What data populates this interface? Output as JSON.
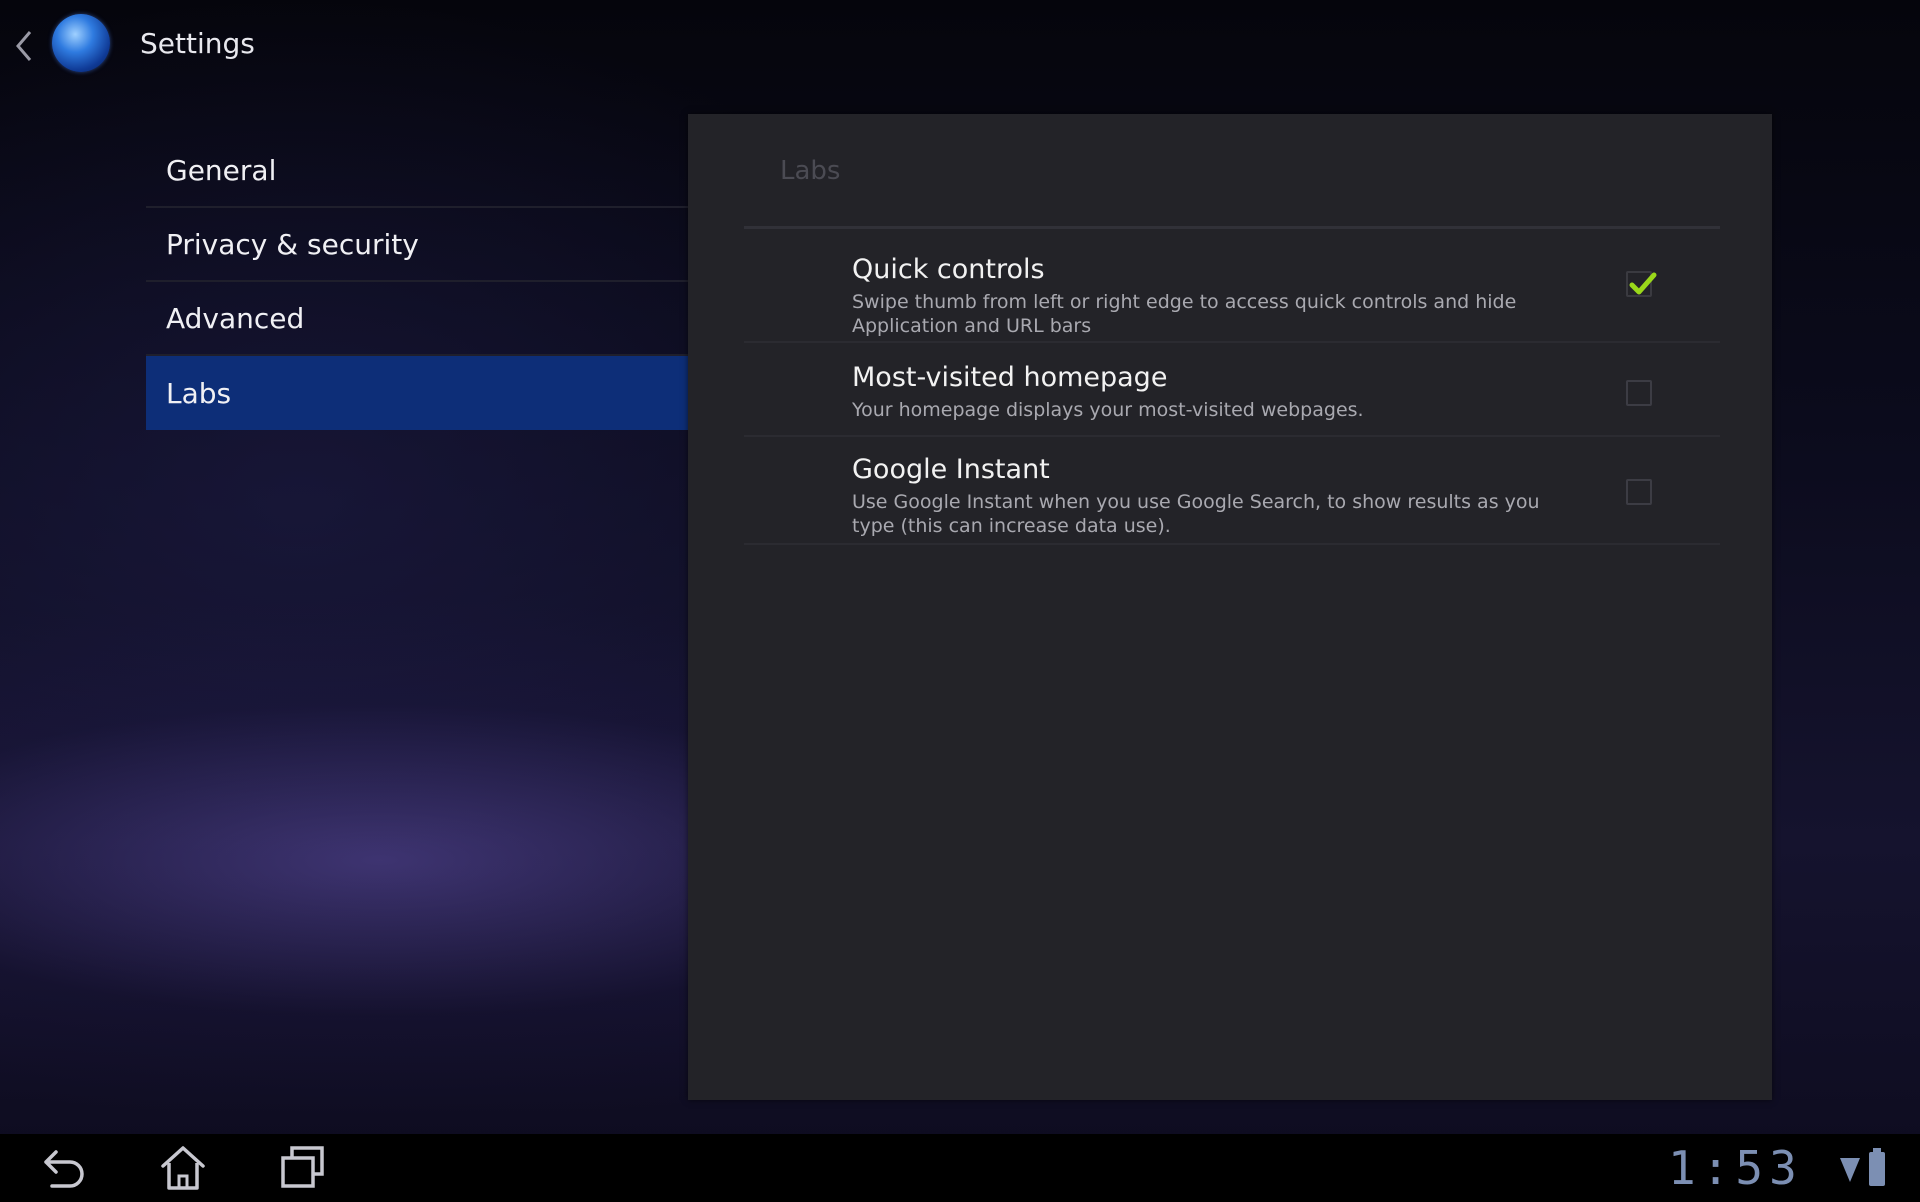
{
  "action_bar": {
    "title": "Settings"
  },
  "categories": [
    {
      "label": "General",
      "selected": false
    },
    {
      "label": "Privacy & security",
      "selected": false
    },
    {
      "label": "Advanced",
      "selected": false
    },
    {
      "label": "Labs",
      "selected": true
    }
  ],
  "pane": {
    "header": "Labs",
    "prefs": [
      {
        "title": "Quick controls",
        "summary": "Swipe thumb from left or right edge to access quick controls and hide Application and URL bars",
        "checked": true
      },
      {
        "title": "Most-visited homepage",
        "summary": "Your homepage displays your most-visited webpages.",
        "checked": false
      },
      {
        "title": "Google Instant",
        "summary": "Use Google Instant when you use Google Search, to show results as you type (this can increase data use).",
        "checked": false
      }
    ]
  },
  "system_bar": {
    "clock": "1:53",
    "icons": [
      "back-icon",
      "home-icon",
      "recent-apps-icon",
      "signal-icon",
      "battery-icon"
    ]
  },
  "colors": {
    "selected_category": "#0d2e78",
    "checkmark": "#9ad81a",
    "clock": "#7c8fb3"
  }
}
